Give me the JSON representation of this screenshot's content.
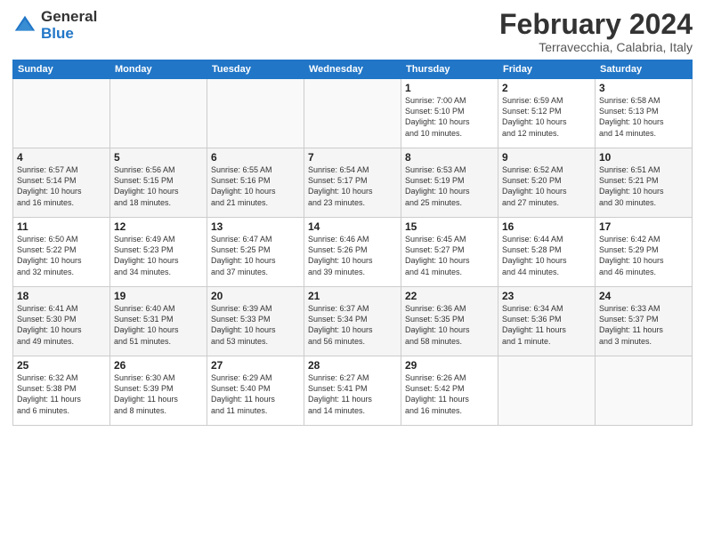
{
  "logo": {
    "line1": "General",
    "line2": "Blue"
  },
  "title": "February 2024",
  "subtitle": "Terravecchia, Calabria, Italy",
  "days_of_week": [
    "Sunday",
    "Monday",
    "Tuesday",
    "Wednesday",
    "Thursday",
    "Friday",
    "Saturday"
  ],
  "weeks": [
    [
      {
        "day": "",
        "info": ""
      },
      {
        "day": "",
        "info": ""
      },
      {
        "day": "",
        "info": ""
      },
      {
        "day": "",
        "info": ""
      },
      {
        "day": "1",
        "info": "Sunrise: 7:00 AM\nSunset: 5:10 PM\nDaylight: 10 hours\nand 10 minutes."
      },
      {
        "day": "2",
        "info": "Sunrise: 6:59 AM\nSunset: 5:12 PM\nDaylight: 10 hours\nand 12 minutes."
      },
      {
        "day": "3",
        "info": "Sunrise: 6:58 AM\nSunset: 5:13 PM\nDaylight: 10 hours\nand 14 minutes."
      }
    ],
    [
      {
        "day": "4",
        "info": "Sunrise: 6:57 AM\nSunset: 5:14 PM\nDaylight: 10 hours\nand 16 minutes."
      },
      {
        "day": "5",
        "info": "Sunrise: 6:56 AM\nSunset: 5:15 PM\nDaylight: 10 hours\nand 18 minutes."
      },
      {
        "day": "6",
        "info": "Sunrise: 6:55 AM\nSunset: 5:16 PM\nDaylight: 10 hours\nand 21 minutes."
      },
      {
        "day": "7",
        "info": "Sunrise: 6:54 AM\nSunset: 5:17 PM\nDaylight: 10 hours\nand 23 minutes."
      },
      {
        "day": "8",
        "info": "Sunrise: 6:53 AM\nSunset: 5:19 PM\nDaylight: 10 hours\nand 25 minutes."
      },
      {
        "day": "9",
        "info": "Sunrise: 6:52 AM\nSunset: 5:20 PM\nDaylight: 10 hours\nand 27 minutes."
      },
      {
        "day": "10",
        "info": "Sunrise: 6:51 AM\nSunset: 5:21 PM\nDaylight: 10 hours\nand 30 minutes."
      }
    ],
    [
      {
        "day": "11",
        "info": "Sunrise: 6:50 AM\nSunset: 5:22 PM\nDaylight: 10 hours\nand 32 minutes."
      },
      {
        "day": "12",
        "info": "Sunrise: 6:49 AM\nSunset: 5:23 PM\nDaylight: 10 hours\nand 34 minutes."
      },
      {
        "day": "13",
        "info": "Sunrise: 6:47 AM\nSunset: 5:25 PM\nDaylight: 10 hours\nand 37 minutes."
      },
      {
        "day": "14",
        "info": "Sunrise: 6:46 AM\nSunset: 5:26 PM\nDaylight: 10 hours\nand 39 minutes."
      },
      {
        "day": "15",
        "info": "Sunrise: 6:45 AM\nSunset: 5:27 PM\nDaylight: 10 hours\nand 41 minutes."
      },
      {
        "day": "16",
        "info": "Sunrise: 6:44 AM\nSunset: 5:28 PM\nDaylight: 10 hours\nand 44 minutes."
      },
      {
        "day": "17",
        "info": "Sunrise: 6:42 AM\nSunset: 5:29 PM\nDaylight: 10 hours\nand 46 minutes."
      }
    ],
    [
      {
        "day": "18",
        "info": "Sunrise: 6:41 AM\nSunset: 5:30 PM\nDaylight: 10 hours\nand 49 minutes."
      },
      {
        "day": "19",
        "info": "Sunrise: 6:40 AM\nSunset: 5:31 PM\nDaylight: 10 hours\nand 51 minutes."
      },
      {
        "day": "20",
        "info": "Sunrise: 6:39 AM\nSunset: 5:33 PM\nDaylight: 10 hours\nand 53 minutes."
      },
      {
        "day": "21",
        "info": "Sunrise: 6:37 AM\nSunset: 5:34 PM\nDaylight: 10 hours\nand 56 minutes."
      },
      {
        "day": "22",
        "info": "Sunrise: 6:36 AM\nSunset: 5:35 PM\nDaylight: 10 hours\nand 58 minutes."
      },
      {
        "day": "23",
        "info": "Sunrise: 6:34 AM\nSunset: 5:36 PM\nDaylight: 11 hours\nand 1 minute."
      },
      {
        "day": "24",
        "info": "Sunrise: 6:33 AM\nSunset: 5:37 PM\nDaylight: 11 hours\nand 3 minutes."
      }
    ],
    [
      {
        "day": "25",
        "info": "Sunrise: 6:32 AM\nSunset: 5:38 PM\nDaylight: 11 hours\nand 6 minutes."
      },
      {
        "day": "26",
        "info": "Sunrise: 6:30 AM\nSunset: 5:39 PM\nDaylight: 11 hours\nand 8 minutes."
      },
      {
        "day": "27",
        "info": "Sunrise: 6:29 AM\nSunset: 5:40 PM\nDaylight: 11 hours\nand 11 minutes."
      },
      {
        "day": "28",
        "info": "Sunrise: 6:27 AM\nSunset: 5:41 PM\nDaylight: 11 hours\nand 14 minutes."
      },
      {
        "day": "29",
        "info": "Sunrise: 6:26 AM\nSunset: 5:42 PM\nDaylight: 11 hours\nand 16 minutes."
      },
      {
        "day": "",
        "info": ""
      },
      {
        "day": "",
        "info": ""
      }
    ]
  ]
}
